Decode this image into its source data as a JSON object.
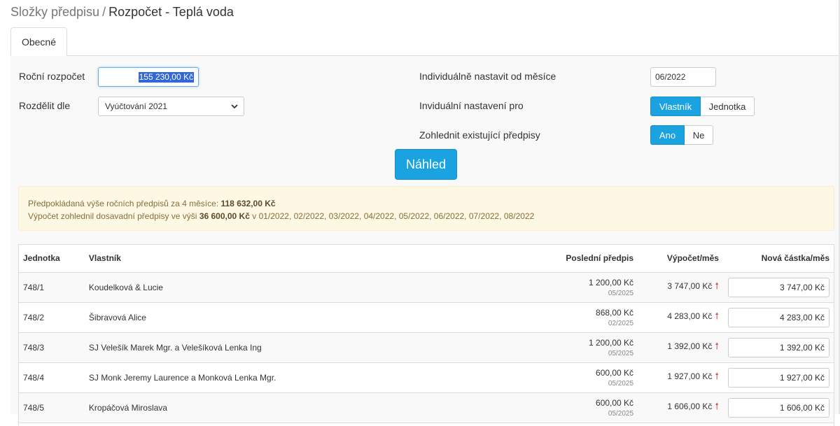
{
  "breadcrumb": {
    "parent": "Složky předpisu",
    "separator": "/",
    "current": "Rozpočet - Teplá voda"
  },
  "tabs": [
    {
      "label": "Obecné",
      "active": true
    }
  ],
  "form": {
    "annual_budget_label": "Roční rozpočet",
    "annual_budget_value": "155 230,00 Kč",
    "split_by_label": "Rozdělit dle",
    "split_by_value": "Vyúčtování 2021",
    "individual_from_label": "Individuálně nastavit od měsíce",
    "individual_from_value": "06/2022",
    "individual_for_label": "Inviduální nastavení pro",
    "individual_for_options": [
      "Vlastník",
      "Jednotka"
    ],
    "individual_for_selected": "Vlastník",
    "consider_existing_label": "Zohlednit existující předpisy",
    "consider_existing_options": [
      "Ano",
      "Ne"
    ],
    "consider_existing_selected": "Ano",
    "preview_label": "Náhled"
  },
  "alert": {
    "line1_prefix": "Předpokládaná výše ročních předpisů za 4 měsíce:",
    "line1_amount": "118 632,00 Kč",
    "line2_prefix": "Výpočet zohlednil dosavadní předpisy ve výši",
    "line2_amount": "36 600,00 Kč",
    "line2_suffix": "v 01/2022, 02/2022, 03/2022, 04/2022, 05/2022, 06/2022, 07/2022, 08/2022"
  },
  "table": {
    "headers": {
      "unit": "Jednotka",
      "owner": "Vlastník",
      "last": "Poslední předpis",
      "calc": "Výpočet/měs",
      "new": "Nová částka/měs"
    },
    "rows": [
      {
        "unit": "748/1",
        "owner": "Koudelková & Lucie",
        "last_amount": "1 200,00 Kč",
        "last_date": "05/2025",
        "calc": "3 747,00 Kč",
        "new": "3 747,00 Kč"
      },
      {
        "unit": "748/2",
        "owner": "Šibravová Alice",
        "last_amount": "868,00 Kč",
        "last_date": "02/2025",
        "calc": "4 283,00 Kč",
        "new": "4 283,00 Kč"
      },
      {
        "unit": "748/3",
        "owner": "SJ Velešík Marek Mgr. a Velešíková Lenka Ing",
        "last_amount": "1 200,00 Kč",
        "last_date": "05/2025",
        "calc": "1 392,00 Kč",
        "new": "1 392,00 Kč"
      },
      {
        "unit": "748/4",
        "owner": "SJ Monk Jeremy Laurence a Monková Lenka Mgr.",
        "last_amount": "600,00 Kč",
        "last_date": "05/2025",
        "calc": "1 927,00 Kč",
        "new": "1 927,00 Kč"
      },
      {
        "unit": "748/5",
        "owner": "Kropáčová Miroslava",
        "last_amount": "600,00 Kč",
        "last_date": "05/2025",
        "calc": "1 606,00 Kč",
        "new": "1 606,00 Kč"
      }
    ]
  },
  "colors": {
    "accent": "#1aa3e0",
    "alert_bg": "#fcf8e3",
    "alert_text": "#8a6d3b",
    "arrow_up": "#d9534f"
  },
  "icons": {
    "select": "chevron-down-icon",
    "trend": "arrow-up-icon"
  }
}
